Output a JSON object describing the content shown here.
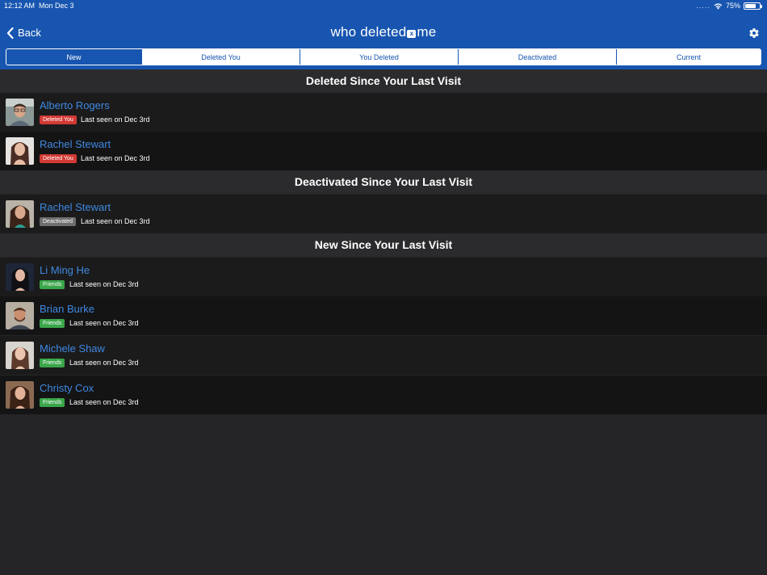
{
  "status_bar": {
    "time": "12:12 AM",
    "date": "Mon Dec 3",
    "signal_dots": ".....",
    "battery": "75%",
    "battery_level": 0.75
  },
  "nav": {
    "back_label": "Back",
    "logo_part1": "who deleted",
    "logo_badge": "x",
    "logo_part2": "me",
    "settings_icon": "gear-icon"
  },
  "tabs": [
    {
      "label": "New",
      "active": true
    },
    {
      "label": "Deleted You",
      "active": false
    },
    {
      "label": "You Deleted",
      "active": false
    },
    {
      "label": "Deactivated",
      "active": false
    },
    {
      "label": "Current",
      "active": false
    }
  ],
  "sections": [
    {
      "title": "Deleted Since Your Last Visit",
      "people": [
        {
          "name": "Alberto Rogers",
          "badge": "Deleted You",
          "status": "Last seen on Dec 3rd"
        },
        {
          "name": "Rachel Stewart",
          "badge": "Deleted You",
          "status": "Last seen on Dec 3rd"
        }
      ]
    },
    {
      "title": "Deactivated Since Your Last Visit",
      "people": [
        {
          "name": "Rachel Stewart",
          "badge": "Deactivated",
          "status": "Last seen on Dec 3rd"
        }
      ]
    },
    {
      "title": "New Since Your Last Visit",
      "people": [
        {
          "name": "Li Ming He",
          "badge": "Friends",
          "status": "Last seen on Dec 3rd"
        },
        {
          "name": "Brian Burke",
          "badge": "Friends",
          "status": "Last seen on Dec 3rd"
        },
        {
          "name": "Michele Shaw",
          "badge": "Friends",
          "status": "Last seen on Dec 3rd"
        },
        {
          "name": "Christy Cox",
          "badge": "Friends",
          "status": "Last seen on Dec 3rd"
        }
      ]
    }
  ],
  "colors": {
    "header_blue": "#1755b0",
    "name_blue": "#3f88e0",
    "badge_deleted": "#d23a35",
    "badge_deactivated": "#6e6e70",
    "badge_friends": "#3aa64a"
  }
}
